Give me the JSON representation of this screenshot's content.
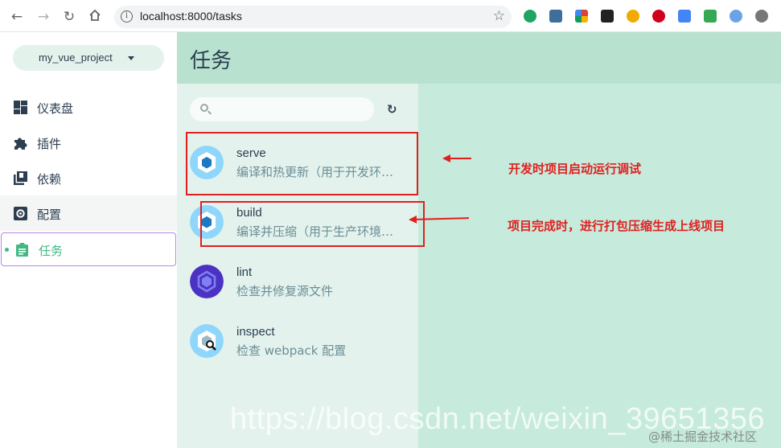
{
  "browser": {
    "url": "localhost:8000/tasks"
  },
  "sidebar": {
    "project": "my_vue_project",
    "items": [
      {
        "label": "仪表盘",
        "icon": "dashboard-icon"
      },
      {
        "label": "插件",
        "icon": "puzzle-icon"
      },
      {
        "label": "依赖",
        "icon": "library-icon"
      },
      {
        "label": "配置",
        "icon": "settings-icon"
      },
      {
        "label": "任务",
        "icon": "assignment-icon"
      }
    ],
    "active_index": 4
  },
  "header": {
    "title": "任务"
  },
  "search": {
    "placeholder": "",
    "value": ""
  },
  "tasks": [
    {
      "name": "serve",
      "desc": "编译和热更新（用于开发环…",
      "icon": "webpack-icon"
    },
    {
      "name": "build",
      "desc": "编译并压缩（用于生产环境…",
      "icon": "webpack-icon"
    },
    {
      "name": "lint",
      "desc": "检查并修复源文件",
      "icon": "eslint-icon"
    },
    {
      "name": "inspect",
      "desc": "检查 webpack 配置",
      "icon": "webpack-inspect-icon"
    }
  ],
  "annotations": {
    "serve_note": "开发时项目启动运行调试",
    "build_note": "项目完成时，进行打包压缩生成上线项目"
  },
  "watermark": {
    "csdn": "https://blog.csdn.net/weixin_39651356",
    "juejin": "@稀土掘金技术社区"
  },
  "colors": {
    "accent": "#42b983",
    "header_bg": "#b8e2cf",
    "task_pane_bg": "#e3f2ec",
    "detail_bg": "#c6eadb",
    "annotation": "#e02020"
  }
}
